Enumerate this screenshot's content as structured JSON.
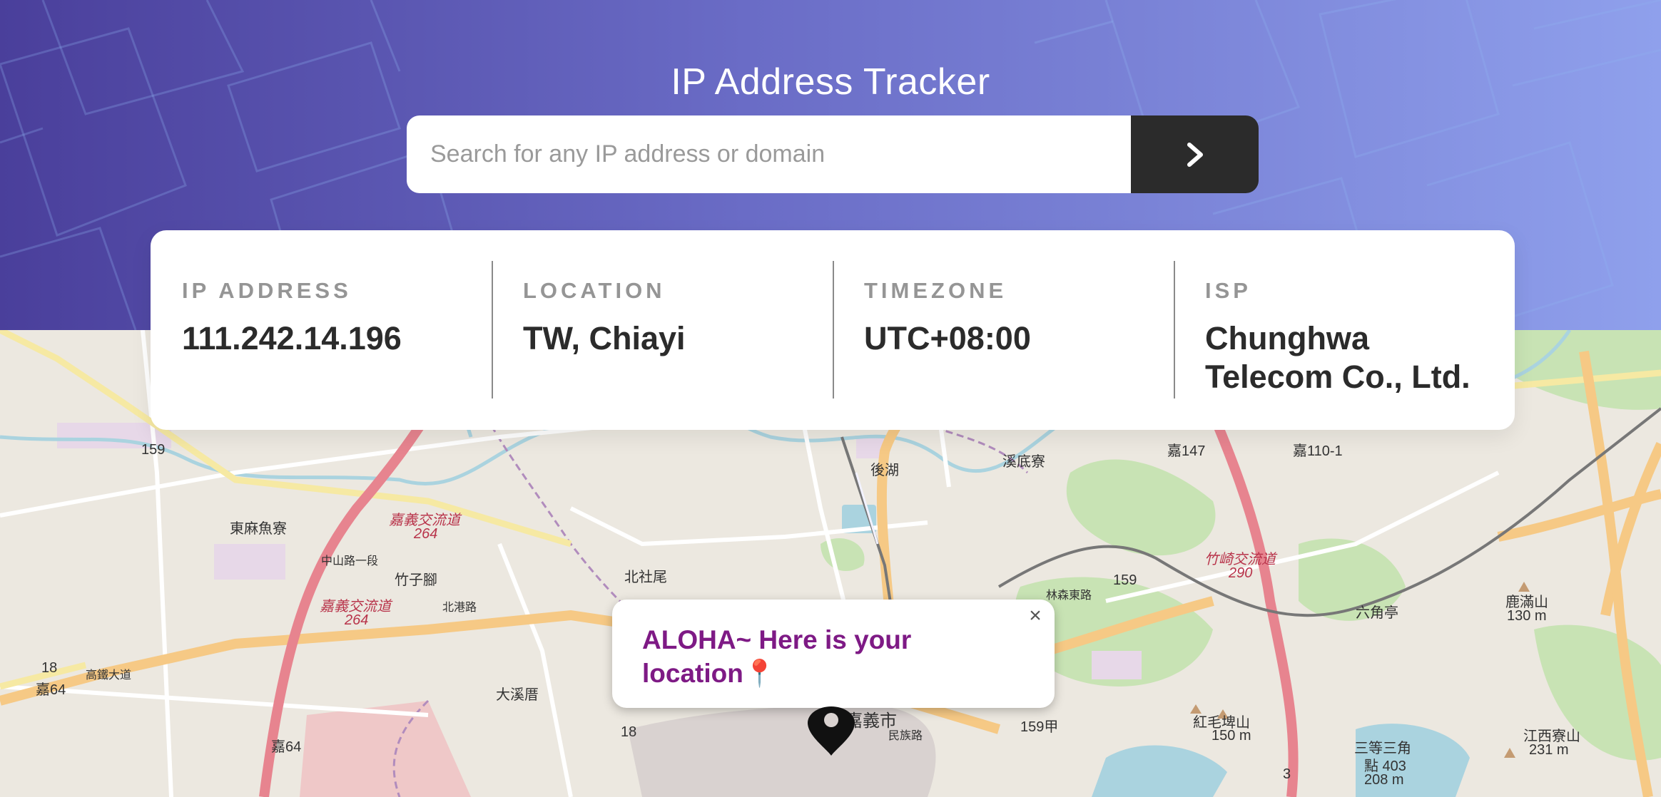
{
  "header": {
    "title": "IP Address Tracker",
    "search_placeholder": "Search for any IP address or domain",
    "submit_icon": "chevron-right-icon"
  },
  "info": {
    "ip": {
      "label": "IP ADDRESS",
      "value": "111.242.14.196"
    },
    "location": {
      "label": "LOCATION",
      "value": "TW, Chiayi"
    },
    "timezone": {
      "label": "TIMEZONE",
      "value": "UTC+08:00"
    },
    "isp": {
      "label": "ISP",
      "value": "Chunghwa Telecom Co., Ltd."
    }
  },
  "map": {
    "popup_text": "ALOHA~ Here is your location📍",
    "close_glyph": "×",
    "labels": {
      "l1": "159",
      "l2": "東麻魚寮",
      "l3": "嘉義交流道",
      "l4": "264",
      "l5": "竹子腳",
      "l6": "嘉義交流道",
      "l7": "264",
      "l8": "北社尾",
      "l9": "後湖",
      "l10": "溪底寮",
      "l11": "嘉147",
      "l12": "嘉110-1",
      "l13": "竹崎交流道",
      "l14": "290",
      "l15": "159",
      "l16": "六角亭",
      "l17": "鹿滿山",
      "l18": "130 m",
      "l19": "18",
      "l20": "嘉64",
      "l21": "大溪厝",
      "l22": "嘉64",
      "l23": "18",
      "l24": "嘉義市",
      "l25": "159甲",
      "l26": "紅毛埤山",
      "l27": "150 m",
      "l28": "三等三角",
      "l29": "點 403",
      "l30": "208 m",
      "l31": "江西寮山",
      "l32": "231 m",
      "l33": "3",
      "l34": "高鐵大道",
      "l35": "北港路",
      "l36": "中山路一段",
      "l37": "林森東路",
      "l38": "民族路"
    },
    "colors": {
      "popup_text": "#7e1a85",
      "highway": "#e7848f",
      "primary_road": "#f6c985",
      "water": "#aad3df"
    }
  }
}
